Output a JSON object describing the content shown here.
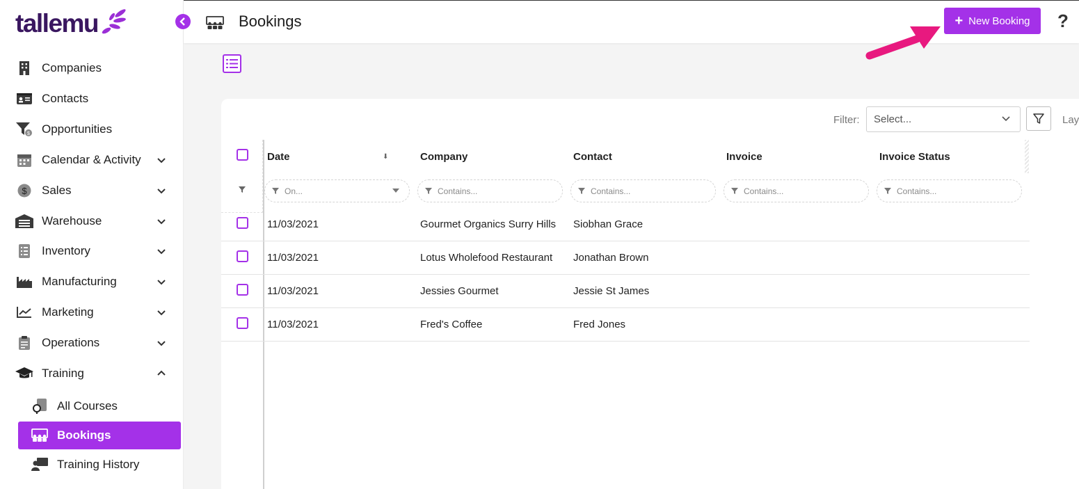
{
  "app": {
    "logo_text": "tallemu"
  },
  "sidebar": {
    "items": [
      {
        "label": "Companies",
        "icon": "building-icon",
        "expandable": false
      },
      {
        "label": "Contacts",
        "icon": "contact-card-icon",
        "expandable": false
      },
      {
        "label": "Opportunities",
        "icon": "funnel-dollar-icon",
        "expandable": false
      },
      {
        "label": "Calendar & Activity",
        "icon": "calendar-icon",
        "expandable": true
      },
      {
        "label": "Sales",
        "icon": "dollar-circle-icon",
        "expandable": true
      },
      {
        "label": "Warehouse",
        "icon": "warehouse-icon",
        "expandable": true
      },
      {
        "label": "Inventory",
        "icon": "inventory-list-icon",
        "expandable": true
      },
      {
        "label": "Manufacturing",
        "icon": "factory-icon",
        "expandable": true
      },
      {
        "label": "Marketing",
        "icon": "chart-trend-icon",
        "expandable": true
      },
      {
        "label": "Operations",
        "icon": "clipboard-icon",
        "expandable": true
      },
      {
        "label": "Training",
        "icon": "graduation-cap-icon",
        "expandable": true,
        "expanded": true
      }
    ],
    "sub_items": [
      {
        "label": "All Courses",
        "icon": "courses-icon",
        "active": false
      },
      {
        "label": "Bookings",
        "icon": "bookings-icon",
        "active": true
      },
      {
        "label": "Training History",
        "icon": "training-history-icon",
        "active": false
      }
    ]
  },
  "header": {
    "title": "Bookings",
    "new_button_label": "New Booking",
    "help_label": "?"
  },
  "toolbar": {
    "filter_label": "Filter:",
    "filter_placeholder": "Select...",
    "layout_label": "Lay"
  },
  "table": {
    "columns": [
      "Date",
      "Company",
      "Contact",
      "Invoice",
      "Invoice Status"
    ],
    "filter_placeholders": [
      "On...",
      "Contains...",
      "Contains...",
      "Contains...",
      "Contains..."
    ],
    "rows": [
      {
        "date": "11/03/2021",
        "company": "Gourmet Organics Surry Hills",
        "contact": "Siobhan Grace",
        "invoice": "",
        "invoice_status": ""
      },
      {
        "date": "11/03/2021",
        "company": "Lotus Wholefood Restaurant",
        "contact": "Jonathan Brown",
        "invoice": "",
        "invoice_status": ""
      },
      {
        "date": "11/03/2021",
        "company": "Jessies Gourmet",
        "contact": "Jessie St James",
        "invoice": "",
        "invoice_status": ""
      },
      {
        "date": "11/03/2021",
        "company": "Fred's Coffee",
        "contact": "Fred Jones",
        "invoice": "",
        "invoice_status": ""
      }
    ]
  },
  "colors": {
    "accent": "#a431e8",
    "logo": "#3a1760",
    "annotation_arrow": "#e8197f"
  }
}
